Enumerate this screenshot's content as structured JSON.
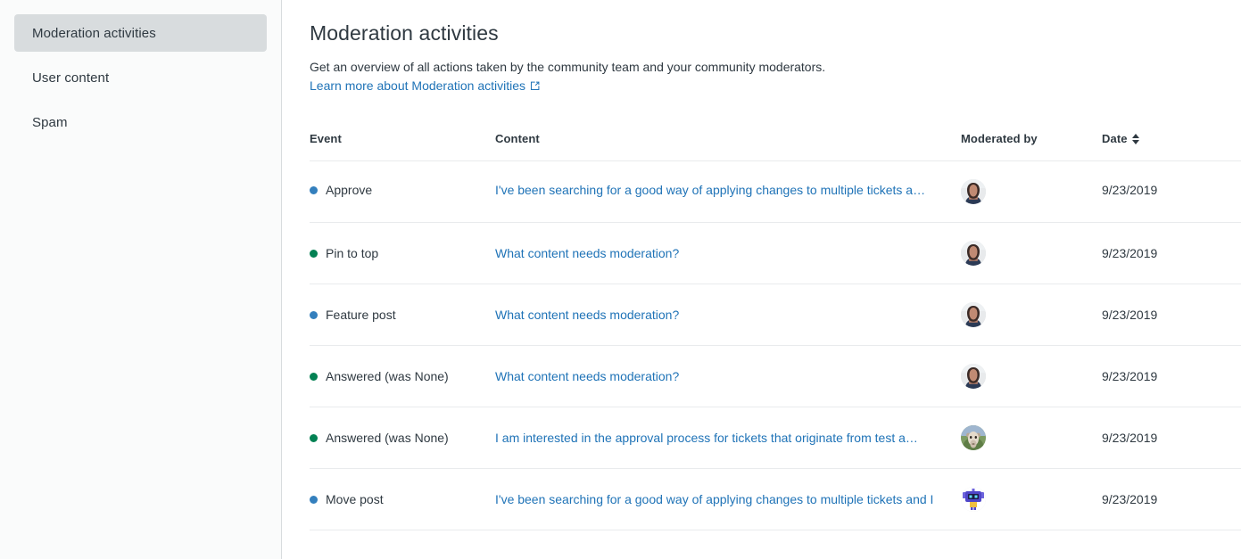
{
  "sidebar": {
    "items": [
      {
        "label": "Moderation activities",
        "active": true
      },
      {
        "label": "User content",
        "active": false
      },
      {
        "label": "Spam",
        "active": false
      }
    ]
  },
  "header": {
    "title": "Moderation activities",
    "description": "Get an overview of all actions taken by the community team and your community moderators.",
    "learn_more_label": "Learn more about Moderation activities",
    "learn_more_icon": "external-link-icon"
  },
  "table": {
    "columns": {
      "event": "Event",
      "content": "Content",
      "moderated_by": "Moderated by",
      "date": "Date"
    },
    "sort_icon": "sort-updown-icon",
    "rows": [
      {
        "event": "Approve",
        "dot_color": "#337fbd",
        "content": "I've been searching for a good way of applying changes to multiple tickets a…",
        "avatar": "avatar-woman-dark-hair",
        "date": "9/23/2019"
      },
      {
        "event": "Pin to top",
        "dot_color": "#038153",
        "content": "What content needs moderation?",
        "avatar": "avatar-woman-dark-hair",
        "date": "9/23/2019"
      },
      {
        "event": "Feature post",
        "dot_color": "#337fbd",
        "content": "What content needs moderation?",
        "avatar": "avatar-woman-dark-hair",
        "date": "9/23/2019"
      },
      {
        "event": "Answered (was None)",
        "dot_color": "#038153",
        "content": "What content needs moderation?",
        "avatar": "avatar-woman-dark-hair",
        "date": "9/23/2019"
      },
      {
        "event": "Answered (was None)",
        "dot_color": "#038153",
        "content": "I am interested in the approval process for tickets that originate from test a…",
        "avatar": "avatar-goat-photo",
        "date": "9/23/2019"
      },
      {
        "event": "Move post",
        "dot_color": "#337fbd",
        "content": "I've been searching for a good way of applying changes to multiple tickets and I",
        "avatar": "avatar-pixel-robot",
        "date": "9/23/2019"
      }
    ]
  },
  "colors": {
    "link": "#1f73b7",
    "text": "#2f3941",
    "sidebar_bg": "#fafbfb",
    "sidebar_active_bg": "#d8dcde",
    "border": "#e9ebed",
    "dot_blue": "#337fbd",
    "dot_green": "#038153"
  }
}
